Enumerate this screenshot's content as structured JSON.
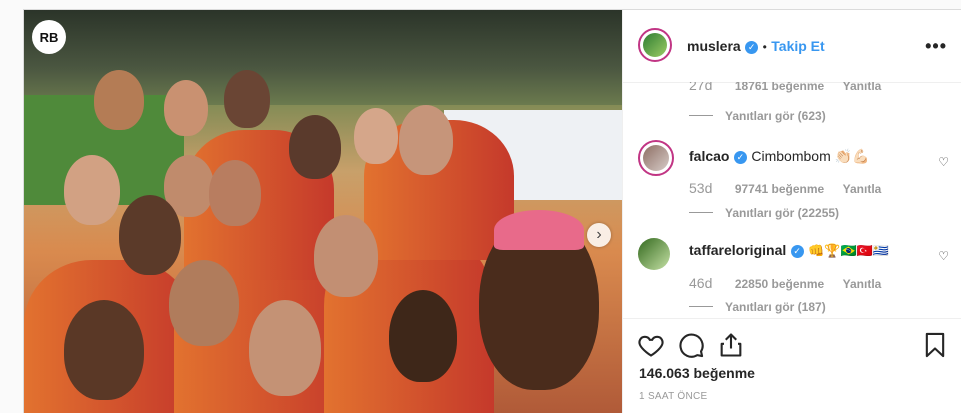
{
  "post": {
    "watermark": "RB"
  },
  "header": {
    "username": "muslera",
    "separator": "•",
    "follow_label": "Takip Et",
    "more_icon": "more-horizontal-icon"
  },
  "comments": [
    {
      "partial": true,
      "time": "27d",
      "likes": "18761 beğenme",
      "reply_label": "Yanıtla",
      "view_replies": "Yanıtları gör (623)"
    },
    {
      "username": "falcao",
      "verified": true,
      "text": "Cimbombom 👏🏻💪🏻",
      "time": "53d",
      "likes": "97741 beğenme",
      "reply_label": "Yanıtla",
      "view_replies": "Yanıtları gör (22255)"
    },
    {
      "username": "taffareloriginal",
      "verified": true,
      "text": "👊🏆🇧🇷🇹🇷🇺🇾",
      "time": "46d",
      "likes": "22850 beğenme",
      "reply_label": "Yanıtla",
      "view_replies": "Yanıtları gör (187)"
    }
  ],
  "actions": {
    "likes": "146.063 beğenme",
    "time_ago": "1 SAAT ÖNCE"
  },
  "colors": {
    "accent": "#3897f0",
    "text": "#262626",
    "muted": "#999999",
    "ring": "#c13584"
  }
}
